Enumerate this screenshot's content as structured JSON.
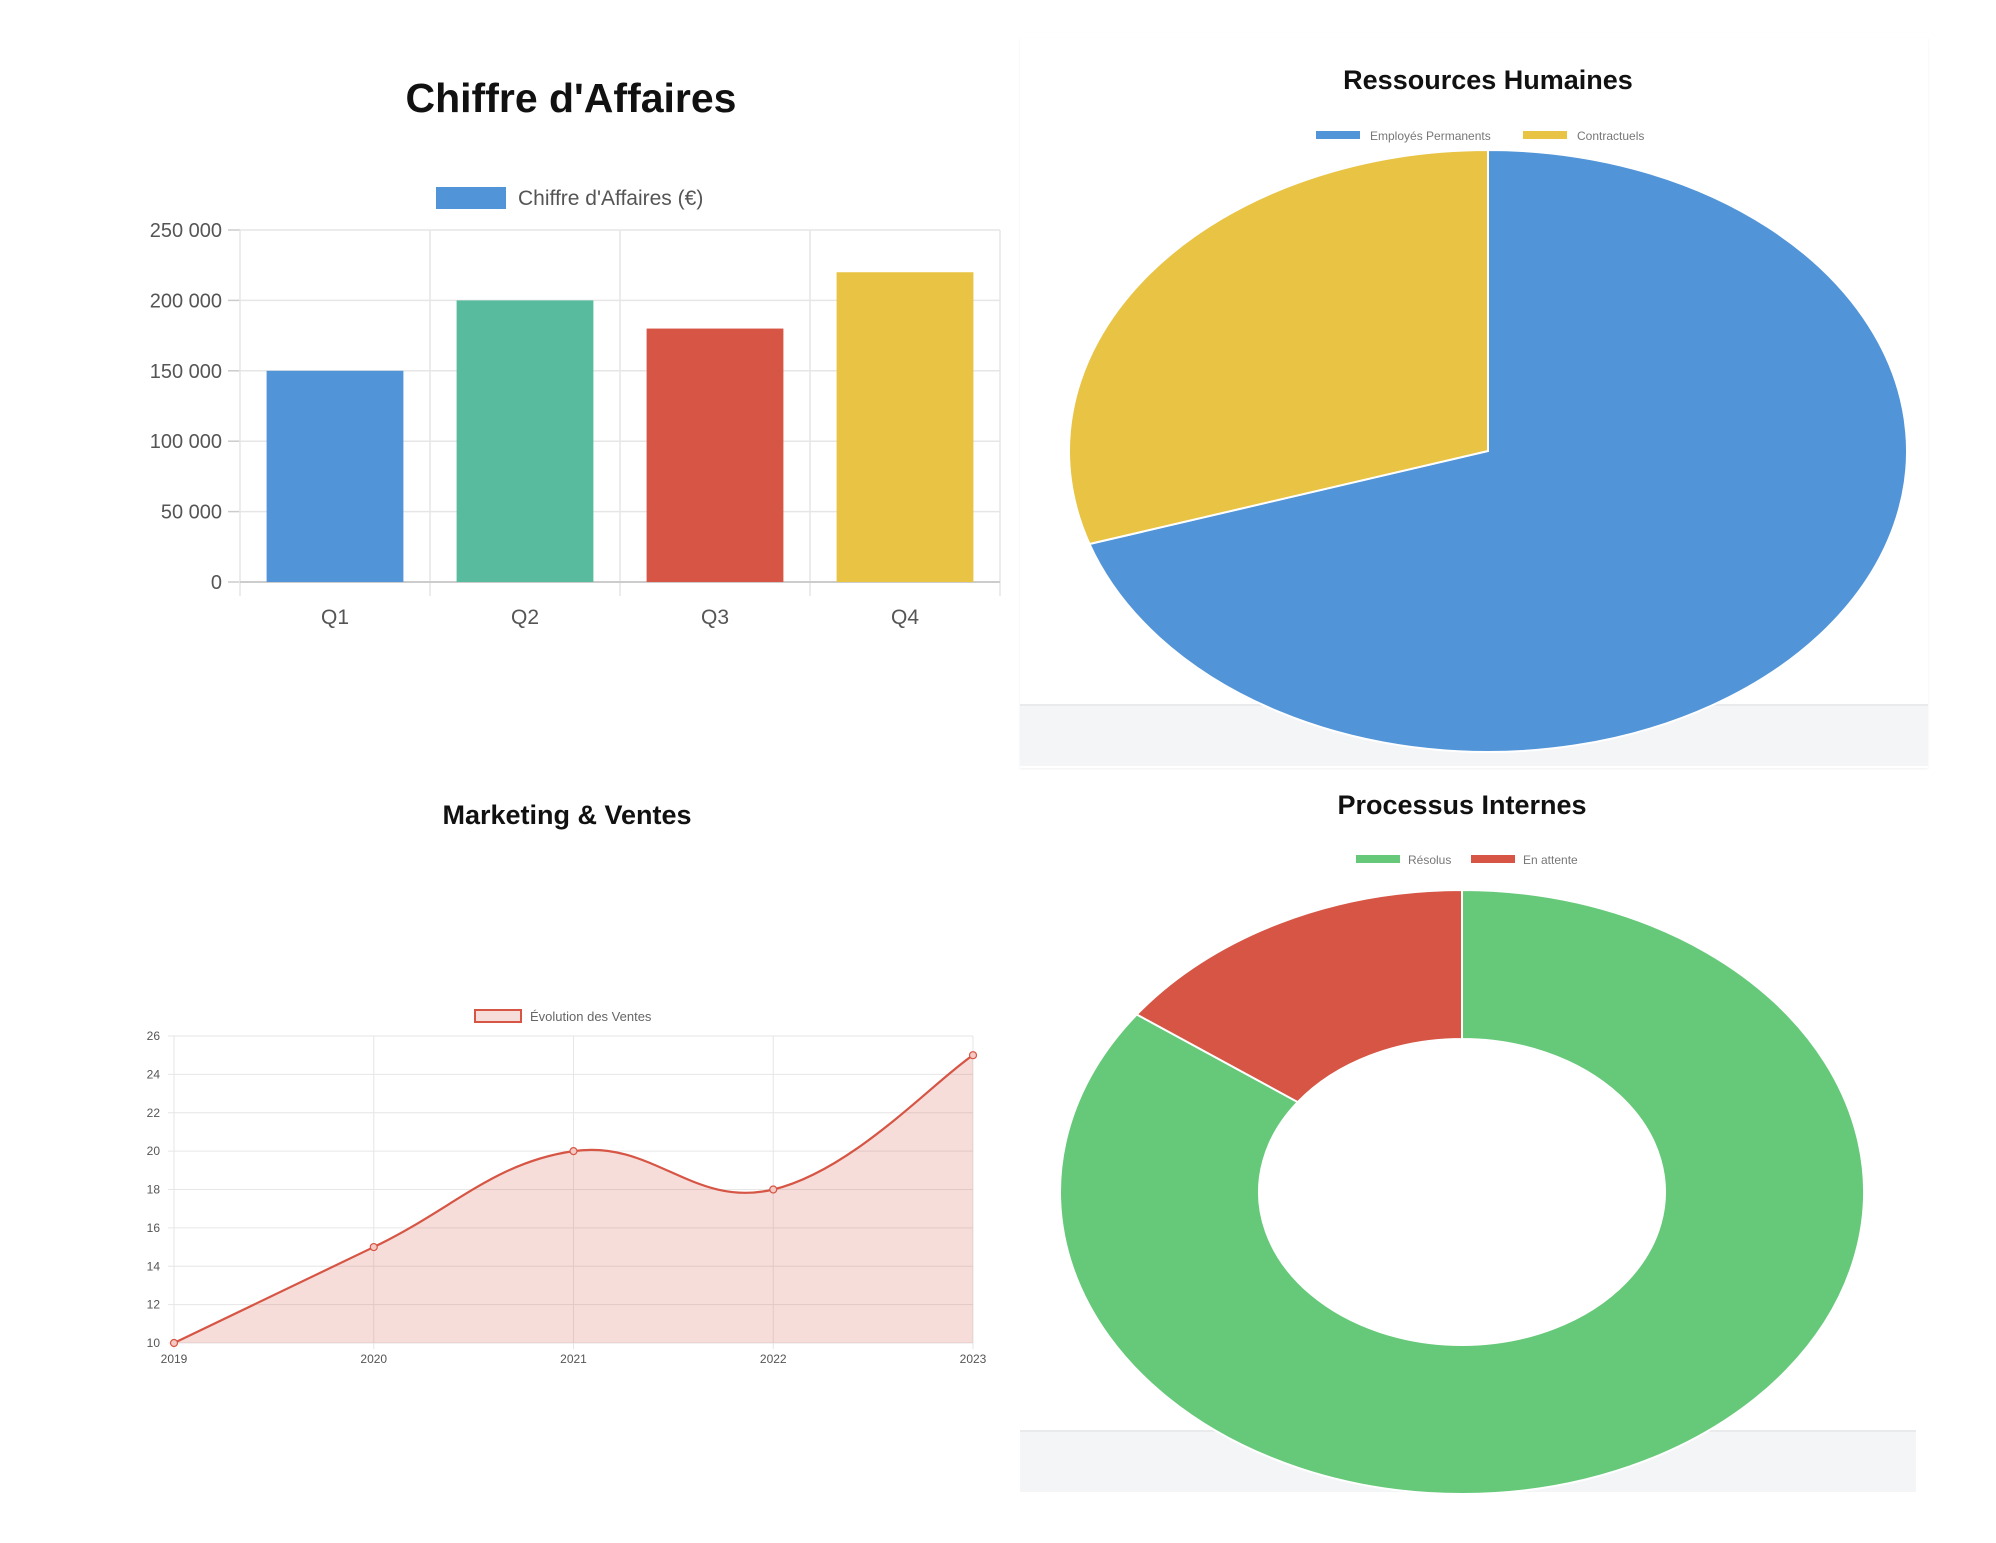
{
  "colors": {
    "blue": "#5294d8",
    "green": "#58bb9e",
    "red": "#d65544",
    "yellow": "#e8c344",
    "bright_green": "#66c97a",
    "grid": "#e6e6e6",
    "axis_text": "#555555",
    "title_text": "#111111"
  },
  "chart_data": [
    {
      "type": "bar",
      "title": "Chiffre d'Affaires",
      "legend": [
        "Chiffre d'Affaires (€)"
      ],
      "legend_position": "top",
      "categories": [
        "Q1",
        "Q2",
        "Q3",
        "Q4"
      ],
      "series": [
        {
          "name": "Chiffre d'Affaires (€)",
          "values": [
            150000,
            200000,
            180000,
            220000
          ]
        }
      ],
      "bar_colors": [
        "#5294d8",
        "#58bb9e",
        "#d65544",
        "#e8c344"
      ],
      "ylim": [
        0,
        250000
      ],
      "yticks": [
        0,
        50000,
        100000,
        150000,
        200000,
        250000
      ],
      "ytick_labels": [
        "0",
        "50 000",
        "100 000",
        "150 000",
        "200 000",
        "250 000"
      ],
      "grid": true
    },
    {
      "type": "pie",
      "title": "Ressources Humaines",
      "legend_position": "top",
      "labels": [
        "Employés Permanents",
        "Contractuels"
      ],
      "values": [
        70,
        30
      ],
      "colors": [
        "#5294d8",
        "#e8c344"
      ]
    },
    {
      "type": "line",
      "title": "Marketing & Ventes",
      "legend_position": "top",
      "x": [
        2019,
        2020,
        2021,
        2022,
        2023
      ],
      "xtick_labels": [
        "2019",
        "2020",
        "2021",
        "2022",
        "2023"
      ],
      "series": [
        {
          "name": "Évolution des Ventes",
          "values": [
            10,
            15,
            20,
            18,
            25
          ]
        }
      ],
      "ylim": [
        10,
        26
      ],
      "yticks": [
        10,
        12,
        14,
        16,
        18,
        20,
        22,
        24,
        26
      ],
      "ytick_labels": [
        "10",
        "12",
        "14",
        "16",
        "18",
        "20",
        "22",
        "24",
        "26"
      ],
      "fill": true,
      "line_color": "#d65544",
      "fill_color": "rgba(214,85,68,0.2)",
      "grid": true
    },
    {
      "type": "pie",
      "subtype": "doughnut",
      "title": "Processus Internes",
      "legend_position": "top",
      "labels": [
        "Résolus",
        "En attente"
      ],
      "values": [
        85,
        15
      ],
      "colors": [
        "#66c97a",
        "#d65544"
      ]
    }
  ]
}
